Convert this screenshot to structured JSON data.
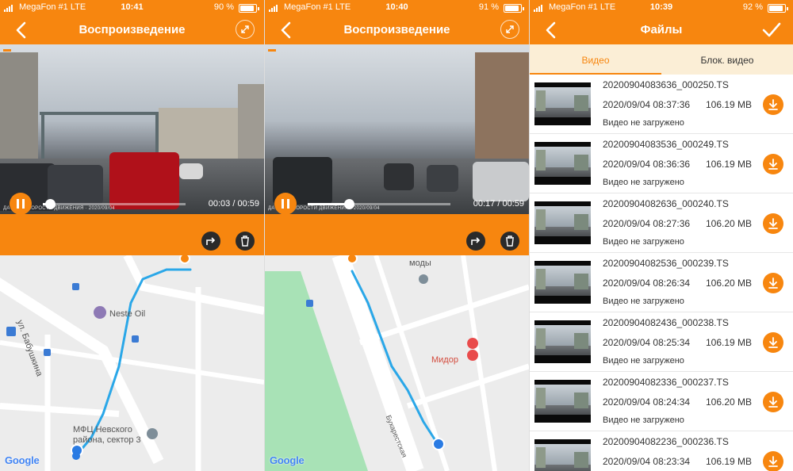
{
  "colors": {
    "accent": "#f7860f",
    "tab_bg": "#fbeed6",
    "route": "#2aa7e8"
  },
  "screens": [
    {
      "status": {
        "carrier": "MegaFon #1  LTE",
        "time": "10:41",
        "battery": "90 %",
        "battery_level": 0.9
      },
      "title": "Воспроизведение",
      "osd": "ДАТЧИК СКОРОСТИ ДВИЖЕНИЯ · 2020/09/04",
      "player": {
        "time": "00:03 / 00:59",
        "progress": 0.05
      },
      "map": {
        "labels": {
          "street": "ул. Бабушкина",
          "poi1": "Neste Oil",
          "poi2": "МФЦ Невского района, сектор 3"
        },
        "google": "Google"
      }
    },
    {
      "status": {
        "carrier": "MegaFon #1  LTE",
        "time": "10:40",
        "battery": "91 %",
        "battery_level": 0.91
      },
      "title": "Воспроизведение",
      "osd": "ДАТЧИК СКОРОСТИ ДВИЖЕНИЯ · 2020/09/04",
      "player": {
        "time": "00:17 / 00:59",
        "progress": 0.29
      },
      "map": {
        "labels": {
          "poi1": "моды",
          "poi2": "Мидор",
          "street": "Бухарестская"
        },
        "google": "Google"
      }
    },
    {
      "status": {
        "carrier": "MegaFon #1  LTE",
        "time": "10:39",
        "battery": "92 %",
        "battery_level": 0.92
      },
      "title": "Файлы",
      "tabs": [
        "Видео",
        "Блок. видео"
      ],
      "files": [
        {
          "name": "20200904083636_000250.TS",
          "date": "2020/09/04 08:37:36",
          "size": "106.19 MB",
          "status": "Видео не загружено"
        },
        {
          "name": "20200904083536_000249.TS",
          "date": "2020/09/04 08:36:36",
          "size": "106.19 MB",
          "status": "Видео не загружено"
        },
        {
          "name": "20200904082636_000240.TS",
          "date": "2020/09/04 08:27:36",
          "size": "106.20 MB",
          "status": "Видео не загружено"
        },
        {
          "name": "20200904082536_000239.TS",
          "date": "2020/09/04 08:26:34",
          "size": "106.20 MB",
          "status": "Видео не загружено"
        },
        {
          "name": "20200904082436_000238.TS",
          "date": "2020/09/04 08:25:34",
          "size": "106.19 MB",
          "status": "Видео не загружено"
        },
        {
          "name": "20200904082336_000237.TS",
          "date": "2020/09/04 08:24:34",
          "size": "106.20 MB",
          "status": "Видео не загружено"
        },
        {
          "name": "20200904082236_000236.TS",
          "date": "2020/09/04 08:23:34",
          "size": "106.19 MB",
          "status": ""
        }
      ]
    }
  ]
}
